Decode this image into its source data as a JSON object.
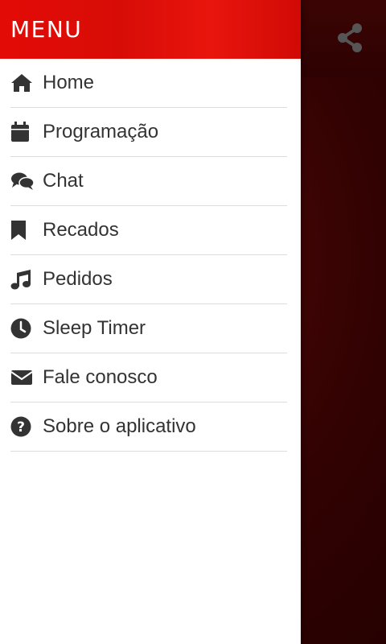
{
  "drawer": {
    "title": "MENU",
    "items": [
      {
        "label": "Home",
        "icon": "home-icon"
      },
      {
        "label": "Programação",
        "icon": "calendar-icon"
      },
      {
        "label": "Chat",
        "icon": "chat-icon"
      },
      {
        "label": "Recados",
        "icon": "bookmark-icon"
      },
      {
        "label": "Pedidos",
        "icon": "music-note-icon"
      },
      {
        "label": "Sleep Timer",
        "icon": "clock-icon"
      },
      {
        "label": "Fale conosco",
        "icon": "envelope-icon"
      },
      {
        "label": "Sobre o aplicativo",
        "icon": "question-circle-icon"
      }
    ]
  },
  "app": {
    "share_icon": "share-icon"
  },
  "colors": {
    "header_red": "#e30b05",
    "background_dark_red": "#2e0202",
    "icon_dark": "#333333",
    "share_gray": "#555555"
  }
}
